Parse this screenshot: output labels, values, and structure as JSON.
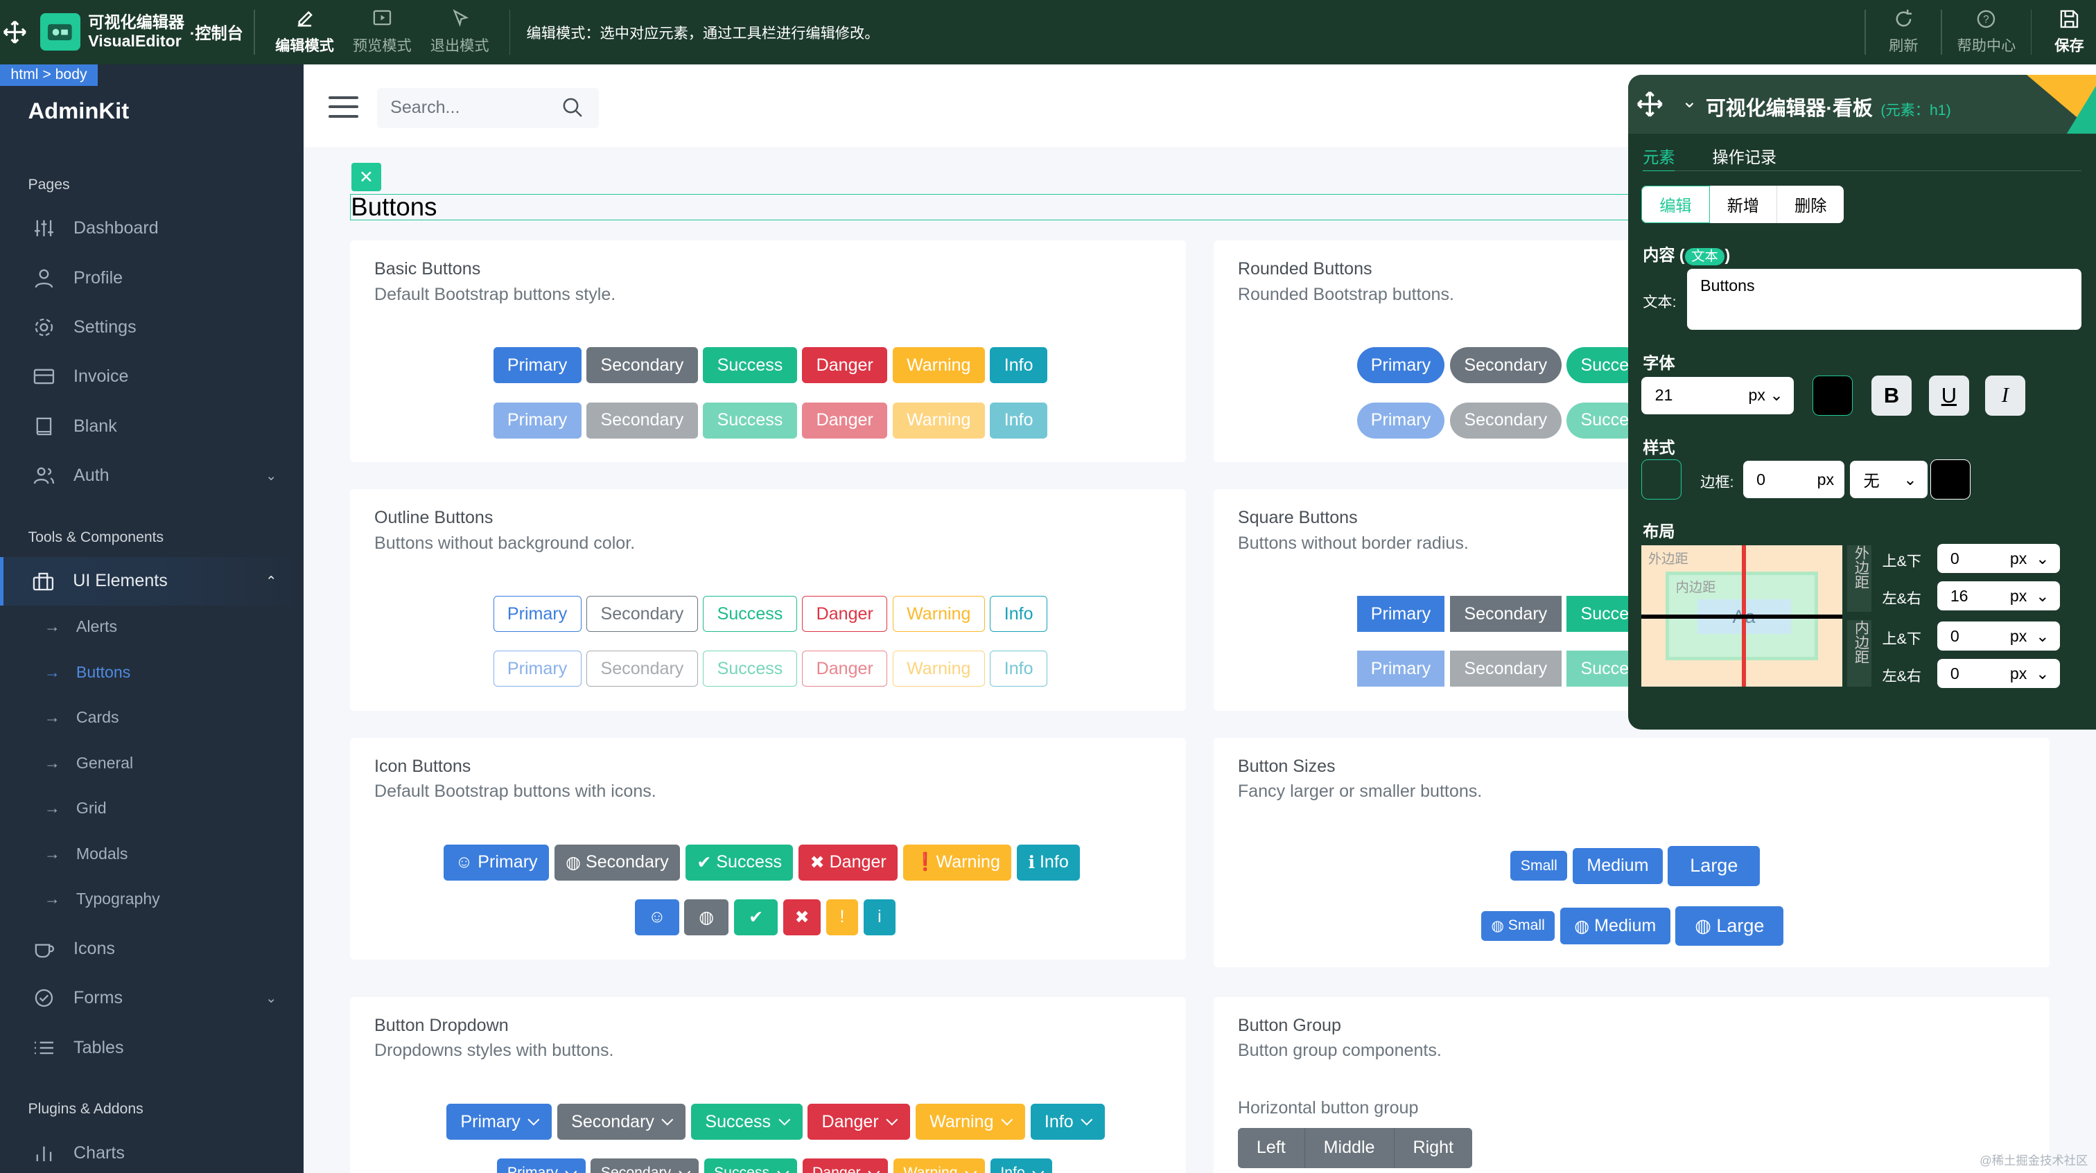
{
  "topbar": {
    "app_title_cn": "可视化编辑器",
    "app_title_en": "VisualEditor",
    "console": "·控制台",
    "tools": [
      {
        "label": "编辑模式",
        "icon": "edit-icon",
        "active": true
      },
      {
        "label": "预览模式",
        "icon": "preview-icon",
        "active": false
      },
      {
        "label": "退出模式",
        "icon": "pointer-icon",
        "active": false
      }
    ],
    "hint": "编辑模式：选中对应元素，通过工具栏进行编辑修改。",
    "right_tools": [
      {
        "label": "刷新",
        "icon": "refresh-icon"
      },
      {
        "label": "帮助中心",
        "icon": "help-icon"
      },
      {
        "label": "保存",
        "icon": "save-icon"
      }
    ],
    "color": "#1c3a2c"
  },
  "breadcrumb": "html > body",
  "sidebar": {
    "brand": "AdminKit",
    "sections": [
      "Pages",
      "Tools & Components",
      "Plugins & Addons"
    ],
    "pages": [
      {
        "label": "Dashboard",
        "icon": "sliders-icon"
      },
      {
        "label": "Profile",
        "icon": "user-icon"
      },
      {
        "label": "Settings",
        "icon": "settings-icon"
      },
      {
        "label": "Invoice",
        "icon": "credit-card-icon"
      },
      {
        "label": "Blank",
        "icon": "book-icon"
      },
      {
        "label": "Auth",
        "icon": "users-icon",
        "expandable": true
      }
    ],
    "ui_elements": {
      "label": "UI Elements",
      "icon": "briefcase-icon",
      "expanded": true
    },
    "sub_items": [
      "Alerts",
      "Buttons",
      "Cards",
      "General",
      "Grid",
      "Modals",
      "Typography"
    ],
    "active_sub": "Buttons",
    "tools": [
      {
        "label": "Icons",
        "icon": "coffee-icon"
      },
      {
        "label": "Forms",
        "icon": "check-circle-icon",
        "expandable": true
      },
      {
        "label": "Tables",
        "icon": "list-icon"
      }
    ],
    "plugins": [
      {
        "label": "Charts",
        "icon": "bar-chart-icon"
      }
    ],
    "color": "#222e3c"
  },
  "header": {
    "search_placeholder": "Search..."
  },
  "page_title": "Buttons",
  "cards": {
    "basic": {
      "title": "Basic Buttons",
      "subtitle": "Default Bootstrap buttons style."
    },
    "rounded": {
      "title": "Rounded Buttons",
      "subtitle": "Rounded Bootstrap buttons."
    },
    "outline": {
      "title": "Outline Buttons",
      "subtitle": "Buttons without background color."
    },
    "square": {
      "title": "Square Buttons",
      "subtitle": "Buttons without border radius."
    },
    "icon": {
      "title": "Icon Buttons",
      "subtitle": "Default Bootstrap buttons with icons."
    },
    "sizes": {
      "title": "Button Sizes",
      "subtitle": "Fancy larger or smaller buttons."
    },
    "dropdown": {
      "title": "Button Dropdown",
      "subtitle": "Dropdowns styles with buttons."
    },
    "group": {
      "title": "Button Group",
      "subtitle": "Button group components.",
      "horizontal_label": "Horizontal button group",
      "group_buttons": [
        "Left",
        "Middle",
        "Right"
      ]
    }
  },
  "buttons": {
    "primary": "Primary",
    "secondary": "Secondary",
    "success": "Success",
    "danger": "Danger",
    "warning": "Warning",
    "info": "Info",
    "success_cut": "Succe",
    "small": "Small",
    "medium": "Medium",
    "large": "Large"
  },
  "editor_panel": {
    "title": "可视化编辑器·看板",
    "element_tag": "(元素：h1)",
    "tabs": [
      "元素",
      "操作记录"
    ],
    "segments": [
      "编辑",
      "新增",
      "删除"
    ],
    "content_label": "内容",
    "content_pill": "文本",
    "text_label": "文本:",
    "text_value": "Buttons",
    "font_label": "字体",
    "font_size": "21",
    "font_unit": "px",
    "bold": "B",
    "underline": "U",
    "italic": "I",
    "style_label": "样式",
    "border_label": "边框:",
    "border_value": "0",
    "border_unit": "px",
    "border_style": "无",
    "layout_label": "布局",
    "margin_label": "外边距",
    "padding_label": "内边距",
    "preview_text": "Aa",
    "outer_vertical": "外边距",
    "inner_vertical": "内边距",
    "rows": [
      {
        "label": "上&下",
        "value": "0",
        "unit": "px"
      },
      {
        "label": "左&右",
        "value": "16",
        "unit": "px"
      },
      {
        "label": "上&下",
        "value": "0",
        "unit": "px"
      },
      {
        "label": "左&右",
        "value": "0",
        "unit": "px"
      }
    ],
    "accent": "#20c997"
  },
  "watermark": "@稀土掘金技术社区"
}
